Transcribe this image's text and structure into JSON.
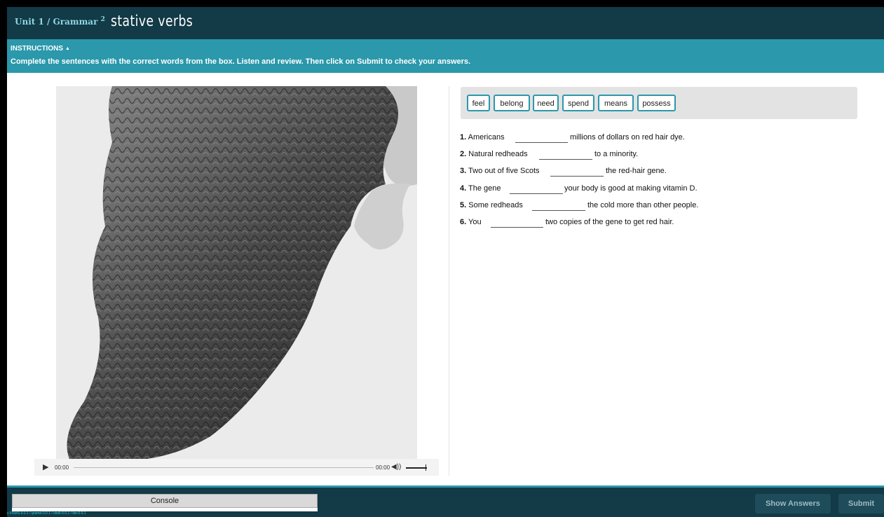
{
  "header": {
    "breadcrumb": "Unit 1 / Grammar",
    "breadcrumb_num": "2",
    "title": "stative verbs"
  },
  "instructions": {
    "label": "INSTRUCTIONS",
    "toggle_glyph": "▲",
    "text": "Complete the sentences with the correct words from the box. Listen and review. Then click on Submit to check your answers."
  },
  "player": {
    "play_glyph": "▶",
    "current_time": "00:00",
    "duration": "00:00",
    "volume_glyph": "◀))"
  },
  "word_box": [
    "feel",
    "belong",
    "need",
    "spend",
    "means",
    "possess"
  ],
  "questions": [
    {
      "num": "1.",
      "before": "Americans",
      "after": "millions of dollars on red hair dye."
    },
    {
      "num": "2.",
      "before": "Natural redheads",
      "after": "to a minority."
    },
    {
      "num": "3.",
      "before": "Two out of five Scots",
      "after": "the red-hair gene."
    },
    {
      "num": "4.",
      "before": "The gene",
      "after": "your body is good at making vitamin D."
    },
    {
      "num": "5.",
      "before": "Some redheads",
      "after": "the cold more than other people."
    },
    {
      "num": "6.",
      "before": "You",
      "after": "two copies of the gene to get red hair."
    }
  ],
  "footer": {
    "console_label": "Console",
    "version": "v FRMS-0.0.1 / gramd-0.0.1 / shell-0.0.1 / lite-0.0.1",
    "show_answers": "Show Answers",
    "submit": "Submit"
  },
  "colors": {
    "header_bg": "#123a47",
    "instructions_bg": "#2b98ab",
    "chip_border": "#2b98ab"
  }
}
